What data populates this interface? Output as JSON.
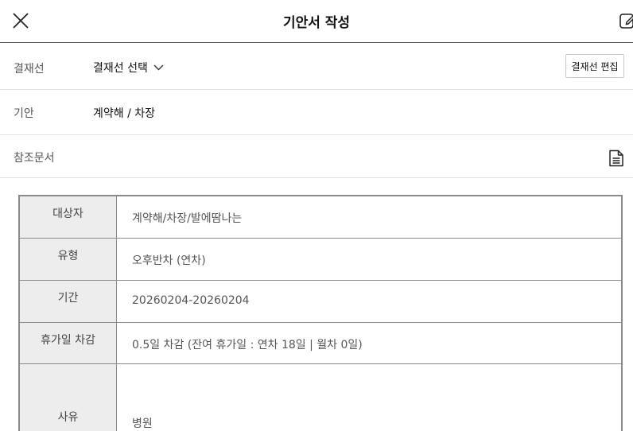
{
  "header": {
    "title": "기안서 작성"
  },
  "approval_line": {
    "label": "결재선",
    "select_label": "결재선 선택",
    "edit_label": "결재선 편집"
  },
  "drafter": {
    "label": "기안",
    "value": "계약해 / 차장"
  },
  "reference": {
    "label": "참조문서"
  },
  "details": {
    "rows": [
      {
        "label": "대상자",
        "value": "계약해/차장/발에땀나는"
      },
      {
        "label": "유형",
        "value": "오후반차 (연차)"
      },
      {
        "label": "기간",
        "value": "20260204-20260204"
      },
      {
        "label": "휴가일 차감",
        "value": "0.5일 차감 (잔여 휴가일 : 연차 18일 | 월차 0일)"
      },
      {
        "label": "사유",
        "value": "병원"
      }
    ]
  }
}
